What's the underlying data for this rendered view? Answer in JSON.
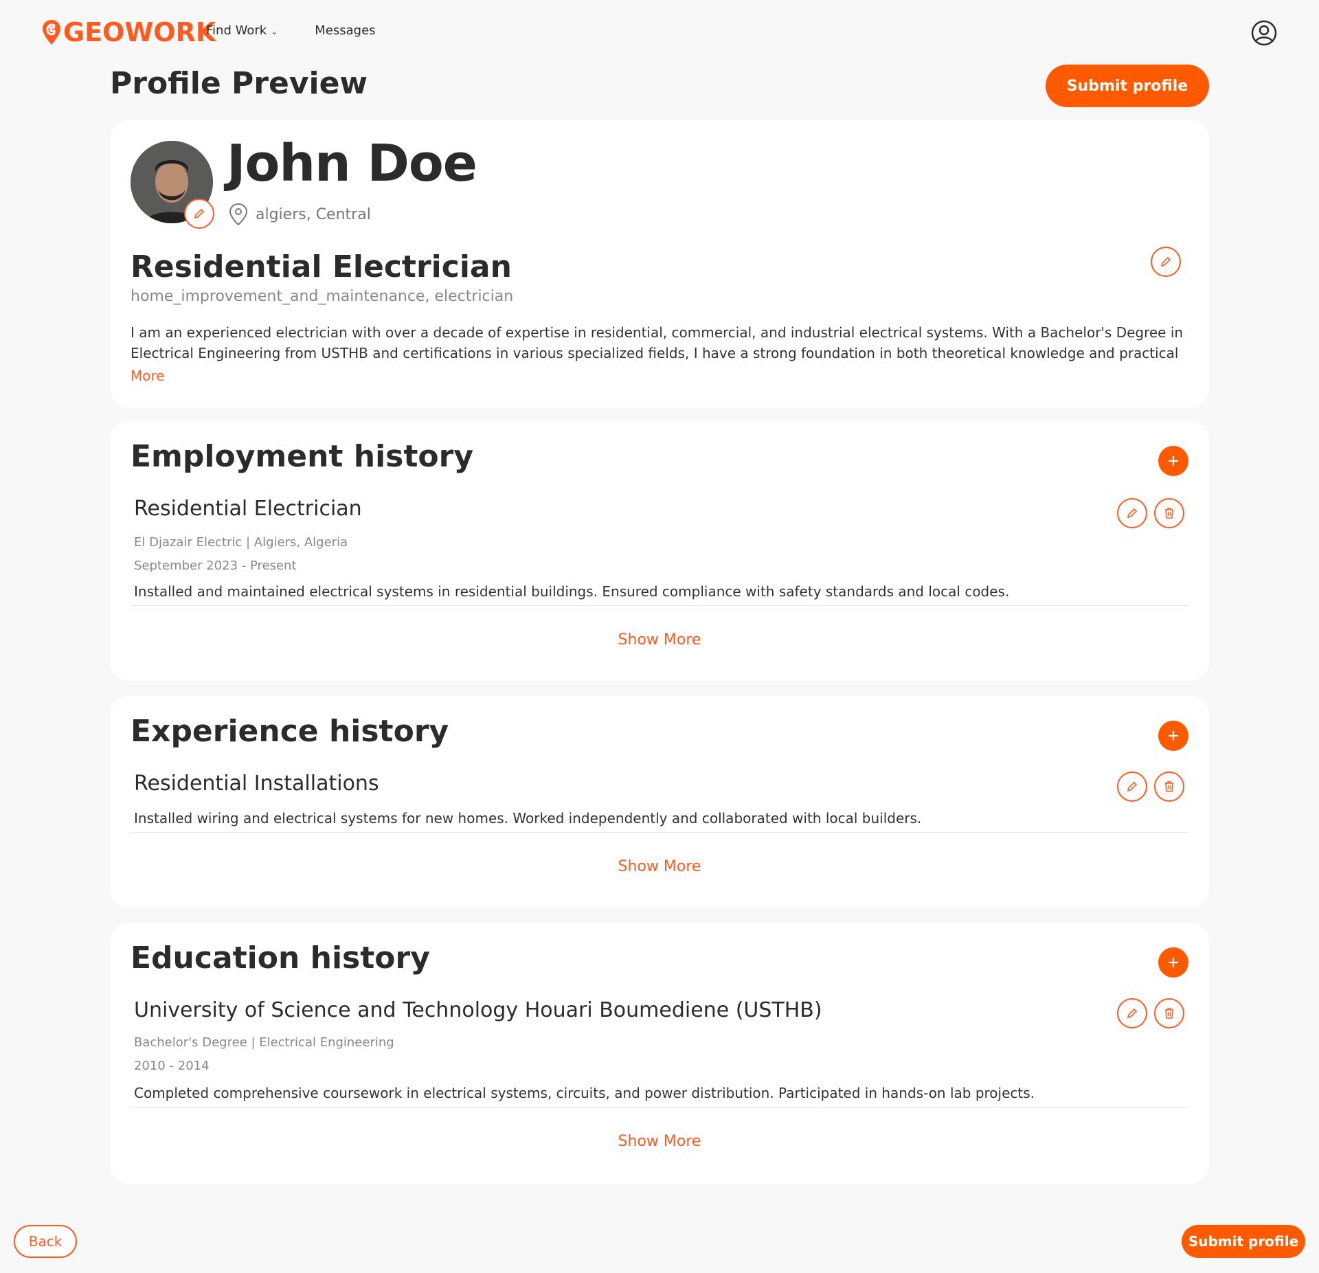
{
  "app": {
    "logo_text": "GEOWORK",
    "brand_color": "#ff5a1f"
  },
  "nav": {
    "find_work": "Find Work",
    "messages": "Messages"
  },
  "header": {
    "page_title": "Profile Preview",
    "submit_label": "Submit profile"
  },
  "profile": {
    "name": "John Doe",
    "location": "algiers, Central",
    "job_title": "Residential Electrician",
    "tags": "home_improvement_and_maintenance, electrician",
    "bio": "I am an experienced electrician with over a decade of expertise in residential, commercial, and industrial electrical systems. With a Bachelor's Degree in Electrical Engineering from USTHB and certifications in various specialized fields, I have a strong foundation in both theoretical knowledge and practical",
    "more_label": "More"
  },
  "employment": {
    "title": "Employment history",
    "entry_title": "Residential Electrician",
    "entry_company": "El Djazair Electric | Algiers, Algeria",
    "entry_dates": "September 2023 - Present",
    "entry_desc": "Installed and maintained electrical systems in residential buildings. Ensured compliance with safety standards and local codes.",
    "show_more": "Show More"
  },
  "experience": {
    "title": "Experience history",
    "entry_title": "Residential Installations",
    "entry_desc": "Installed wiring and electrical systems for new homes. Worked independently and collaborated with local builders.",
    "show_more": "Show More"
  },
  "education": {
    "title": "Education history",
    "entry_title": "University of Science and Technology Houari Boumediene (USTHB)",
    "entry_degree": "Bachelor's Degree | Electrical Engineering",
    "entry_dates": "2010 - 2014",
    "entry_desc": "Completed comprehensive coursework in electrical systems, circuits, and power distribution. Participated in hands-on lab projects.",
    "show_more": "Show More"
  },
  "footer": {
    "back_label": "Back",
    "submit_label": "Submit profile"
  },
  "icons": {
    "user": "user-circle-icon",
    "edit": "pencil-icon",
    "delete": "trash-icon",
    "add": "plus-icon",
    "location": "map-pin-icon",
    "dropdown": "chevron-down-icon"
  }
}
